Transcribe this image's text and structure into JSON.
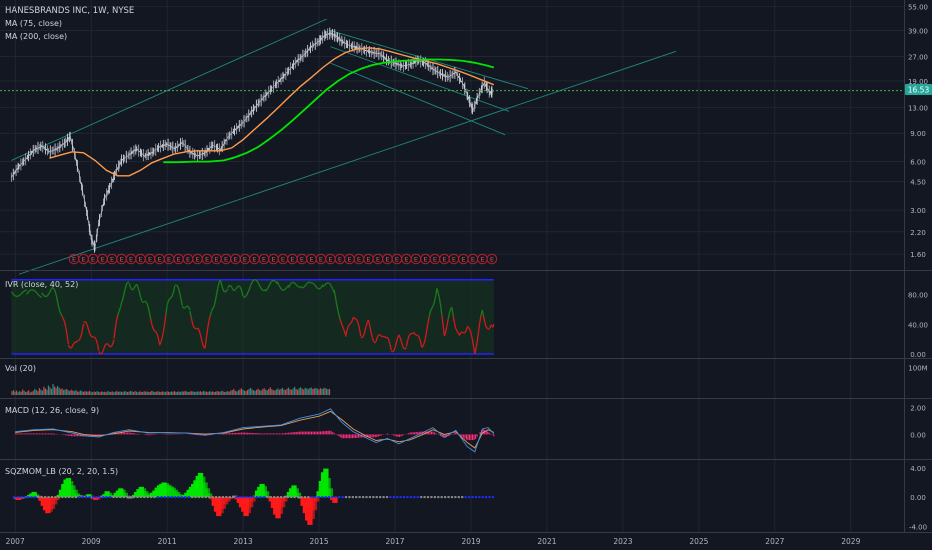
{
  "theme": {
    "background": "#131722",
    "grid": "#2a2e39",
    "separator": "#363a45",
    "text": "#d1d4dc",
    "axis_text": "#b2b5be",
    "price_up": "#cfd2db",
    "ma75_color": "#ff9a4d",
    "ma200_color": "#00e600",
    "channel_color": "#1f8a7d",
    "last_price_line": "#4caf50",
    "earnings_color": "#b3202a",
    "ivr_green": "#1b7a1b",
    "ivr_red": "#d21a1a",
    "ivr_band": "#2323ff",
    "macd_line": "#4a90e2",
    "signal_line": "#e0a060",
    "macd_hist": "#ff2d7a",
    "sqz_green": "#00e600",
    "sqz_red": "#ff1a1a",
    "sqz_gray": "#8c8c8c",
    "vol_up": "#26a69a",
    "vol_down": "#ef5350"
  },
  "header": {
    "symbol_title": "HANESBRANDS INC, 1W, NYSE",
    "ma75_label": "MA (75, close)",
    "ma200_label": "MA (200, close)"
  },
  "last_price_label": "16.53",
  "earnings_marker_label": "E",
  "panes": {
    "ivr": {
      "title": "IVR (close, 40, 52)",
      "ticks": [
        "80.00",
        "40.00",
        "0.00"
      ]
    },
    "vol": {
      "title": "Vol (20)",
      "ticks": [
        "100M"
      ]
    },
    "macd": {
      "title": "MACD (12, 26, close, 9)",
      "ticks": [
        "2.00",
        "0.00"
      ]
    },
    "sqz": {
      "title": "SQZMOM_LB (20, 2, 20, 1.5)",
      "ticks": [
        "4.00",
        "0.00",
        "-4.00"
      ]
    }
  },
  "chart_data": {
    "type": "line",
    "x_axis_labels": [
      "2007",
      "2009",
      "2011",
      "2013",
      "2015",
      "2017",
      "2019",
      "2021",
      "2023",
      "2025",
      "2027",
      "2029"
    ],
    "x_range": [
      2006.6,
      2030.4
    ],
    "price_axis_ticks": [
      "55.00",
      "39.00",
      "27.00",
      "19.00",
      "13.00",
      "9.00",
      "6.00",
      "4.50",
      "3.00",
      "2.20",
      "1.60"
    ],
    "price_scale": "log",
    "price_range": [
      1.35,
      57
    ],
    "last_price": 16.53,
    "price_series": [
      [
        2006.9,
        4.8
      ],
      [
        2007.1,
        5.6
      ],
      [
        2007.3,
        6.3
      ],
      [
        2007.5,
        7.1
      ],
      [
        2007.7,
        7.5
      ],
      [
        2007.9,
        6.9
      ],
      [
        2008.1,
        7.2
      ],
      [
        2008.3,
        7.8
      ],
      [
        2008.45,
        8.6
      ],
      [
        2008.6,
        6.2
      ],
      [
        2008.75,
        4.2
      ],
      [
        2008.9,
        2.8
      ],
      [
        2009.0,
        2.0
      ],
      [
        2009.1,
        1.75
      ],
      [
        2009.2,
        2.5
      ],
      [
        2009.35,
        3.5
      ],
      [
        2009.5,
        4.2
      ],
      [
        2009.65,
        5.2
      ],
      [
        2009.8,
        6.1
      ],
      [
        2010.0,
        6.6
      ],
      [
        2010.2,
        7.2
      ],
      [
        2010.4,
        6.5
      ],
      [
        2010.6,
        6.8
      ],
      [
        2010.8,
        7.4
      ],
      [
        2011.0,
        7.7
      ],
      [
        2011.2,
        7.2
      ],
      [
        2011.4,
        7.9
      ],
      [
        2011.6,
        6.9
      ],
      [
        2011.8,
        6.5
      ],
      [
        2012.0,
        6.8
      ],
      [
        2012.2,
        7.6
      ],
      [
        2012.4,
        7.1
      ],
      [
        2012.6,
        8.5
      ],
      [
        2012.8,
        9.5
      ],
      [
        2013.0,
        10.5
      ],
      [
        2013.2,
        12.0
      ],
      [
        2013.4,
        13.8
      ],
      [
        2013.6,
        15.5
      ],
      [
        2013.8,
        17.5
      ],
      [
        2014.0,
        19.5
      ],
      [
        2014.2,
        22.0
      ],
      [
        2014.4,
        25.0
      ],
      [
        2014.6,
        27.5
      ],
      [
        2014.8,
        31.0
      ],
      [
        2015.0,
        33.5
      ],
      [
        2015.15,
        36.5
      ],
      [
        2015.3,
        37.5
      ],
      [
        2015.45,
        36.0
      ],
      [
        2015.6,
        33.5
      ],
      [
        2015.8,
        31.5
      ],
      [
        2016.0,
        30.5
      ],
      [
        2016.2,
        29.5
      ],
      [
        2016.4,
        28.5
      ],
      [
        2016.6,
        28.0
      ],
      [
        2016.8,
        25.5
      ],
      [
        2017.0,
        24.5
      ],
      [
        2017.2,
        23.5
      ],
      [
        2017.4,
        24.0
      ],
      [
        2017.6,
        25.5
      ],
      [
        2017.8,
        24.5
      ],
      [
        2018.0,
        22.5
      ],
      [
        2018.2,
        21.0
      ],
      [
        2018.4,
        20.0
      ],
      [
        2018.6,
        21.5
      ],
      [
        2018.8,
        18.0
      ],
      [
        2018.95,
        14.5
      ],
      [
        2019.05,
        12.5
      ],
      [
        2019.2,
        15.5
      ],
      [
        2019.35,
        18.5
      ],
      [
        2019.5,
        16.0
      ],
      [
        2019.6,
        16.53
      ]
    ],
    "ma75_series": [
      [
        2007.9,
        6.3
      ],
      [
        2008.2,
        6.6
      ],
      [
        2008.5,
        6.9
      ],
      [
        2008.8,
        6.8
      ],
      [
        2009.1,
        6.1
      ],
      [
        2009.4,
        5.3
      ],
      [
        2009.7,
        4.9
      ],
      [
        2010.0,
        4.9
      ],
      [
        2010.3,
        5.3
      ],
      [
        2010.6,
        5.9
      ],
      [
        2010.9,
        6.3
      ],
      [
        2011.2,
        6.7
      ],
      [
        2011.5,
        6.9
      ],
      [
        2011.8,
        7.0
      ],
      [
        2012.1,
        7.0
      ],
      [
        2012.4,
        7.0
      ],
      [
        2012.7,
        7.3
      ],
      [
        2013.0,
        8.2
      ],
      [
        2013.3,
        9.5
      ],
      [
        2013.6,
        11.0
      ],
      [
        2013.9,
        12.8
      ],
      [
        2014.2,
        15.0
      ],
      [
        2014.5,
        17.5
      ],
      [
        2014.8,
        20.0
      ],
      [
        2015.1,
        23.0
      ],
      [
        2015.4,
        26.0
      ],
      [
        2015.7,
        28.5
      ],
      [
        2016.0,
        30.0
      ],
      [
        2016.3,
        30.5
      ],
      [
        2016.6,
        30.0
      ],
      [
        2016.9,
        28.8
      ],
      [
        2017.2,
        27.5
      ],
      [
        2017.5,
        26.3
      ],
      [
        2017.8,
        25.3
      ],
      [
        2018.1,
        24.3
      ],
      [
        2018.4,
        23.0
      ],
      [
        2018.7,
        21.8
      ],
      [
        2019.0,
        20.5
      ],
      [
        2019.3,
        19.2
      ],
      [
        2019.6,
        18.0
      ]
    ],
    "ma200_series": [
      [
        2010.9,
        5.95
      ],
      [
        2011.3,
        5.95
      ],
      [
        2011.7,
        6.0
      ],
      [
        2012.1,
        6.0
      ],
      [
        2012.5,
        6.1
      ],
      [
        2012.8,
        6.4
      ],
      [
        2013.1,
        6.8
      ],
      [
        2013.4,
        7.4
      ],
      [
        2013.7,
        8.3
      ],
      [
        2014.0,
        9.4
      ],
      [
        2014.3,
        10.8
      ],
      [
        2014.6,
        12.5
      ],
      [
        2014.9,
        14.5
      ],
      [
        2015.2,
        16.8
      ],
      [
        2015.5,
        19.0
      ],
      [
        2015.8,
        21.0
      ],
      [
        2016.1,
        22.6
      ],
      [
        2016.4,
        23.8
      ],
      [
        2016.7,
        24.6
      ],
      [
        2017.0,
        25.1
      ],
      [
        2017.3,
        25.4
      ],
      [
        2017.6,
        25.6
      ],
      [
        2017.9,
        25.8
      ],
      [
        2018.2,
        25.8
      ],
      [
        2018.5,
        25.6
      ],
      [
        2018.8,
        25.3
      ],
      [
        2019.1,
        24.6
      ],
      [
        2019.4,
        23.7
      ],
      [
        2019.6,
        23.0
      ]
    ],
    "channel_lines": [
      {
        "from": [
          2006.9,
          6.1
        ],
        "to": [
          2015.2,
          46.0
        ]
      },
      {
        "from": [
          2007.1,
          1.2
        ],
        "to": [
          2024.4,
          29.0
        ]
      },
      {
        "from": [
          2015.3,
          39.0
        ],
        "to": [
          2020.5,
          17.0
        ]
      },
      {
        "from": [
          2015.3,
          31.0
        ],
        "to": [
          2020.0,
          12.3
        ]
      },
      {
        "from": [
          2015.3,
          24.5
        ],
        "to": [
          2019.9,
          8.8
        ]
      }
    ],
    "earnings_dates": [
      2008.55,
      2008.8,
      2009.05,
      2009.3,
      2009.55,
      2009.8,
      2010.05,
      2010.3,
      2010.55,
      2010.8,
      2011.05,
      2011.3,
      2011.55,
      2011.8,
      2012.05,
      2012.3,
      2012.55,
      2012.8,
      2013.05,
      2013.3,
      2013.55,
      2013.8,
      2014.05,
      2014.3,
      2014.55,
      2014.8,
      2015.05,
      2015.3,
      2015.55,
      2015.8,
      2016.05,
      2016.3,
      2016.55,
      2016.8,
      2017.05,
      2017.3,
      2017.55,
      2017.8,
      2018.05,
      2018.3,
      2018.55,
      2018.8,
      2019.05,
      2019.3,
      2019.55
    ],
    "ivr_range": [
      0,
      105
    ],
    "ivr_series": [
      [
        2006.9,
        85
      ],
      [
        2007.3,
        80
      ],
      [
        2007.7,
        82
      ],
      [
        2008.0,
        85
      ],
      [
        2008.2,
        60
      ],
      [
        2008.4,
        15
      ],
      [
        2008.6,
        10
      ],
      [
        2008.8,
        40
      ],
      [
        2009.0,
        30
      ],
      [
        2009.2,
        5
      ],
      [
        2009.4,
        8
      ],
      [
        2009.6,
        20
      ],
      [
        2009.8,
        75
      ],
      [
        2010.0,
        95
      ],
      [
        2010.2,
        88
      ],
      [
        2010.4,
        72
      ],
      [
        2010.6,
        45
      ],
      [
        2010.8,
        10
      ],
      [
        2011.0,
        60
      ],
      [
        2011.2,
        95
      ],
      [
        2011.4,
        70
      ],
      [
        2011.6,
        55
      ],
      [
        2011.8,
        30
      ],
      [
        2012.0,
        12
      ],
      [
        2012.2,
        65
      ],
      [
        2012.4,
        95
      ],
      [
        2012.6,
        85
      ],
      [
        2012.8,
        92
      ],
      [
        2013.0,
        80
      ],
      [
        2013.3,
        95
      ],
      [
        2013.6,
        90
      ],
      [
        2013.9,
        95
      ],
      [
        2014.2,
        88
      ],
      [
        2014.5,
        96
      ],
      [
        2014.8,
        90
      ],
      [
        2015.1,
        95
      ],
      [
        2015.4,
        85
      ],
      [
        2015.7,
        20
      ],
      [
        2015.9,
        55
      ],
      [
        2016.1,
        25
      ],
      [
        2016.3,
        40
      ],
      [
        2016.5,
        15
      ],
      [
        2016.7,
        30
      ],
      [
        2016.9,
        5
      ],
      [
        2017.1,
        20
      ],
      [
        2017.3,
        10
      ],
      [
        2017.5,
        35
      ],
      [
        2017.7,
        8
      ],
      [
        2017.9,
        45
      ],
      [
        2018.1,
        90
      ],
      [
        2018.3,
        30
      ],
      [
        2018.5,
        60
      ],
      [
        2018.7,
        20
      ],
      [
        2018.9,
        40
      ],
      [
        2019.1,
        5
      ],
      [
        2019.3,
        55
      ],
      [
        2019.5,
        30
      ],
      [
        2019.6,
        45
      ]
    ],
    "ivr_threshold": 50,
    "volume_range": [
      0,
      120000000
    ],
    "volume_start": 2006.9,
    "volume_step": 0.04,
    "volume_values": [
      14,
      18,
      12,
      16,
      10,
      14,
      12,
      20,
      15,
      11,
      13,
      17,
      9,
      12,
      15,
      22,
      18,
      14,
      25,
      20,
      16,
      30,
      24,
      19,
      35,
      28,
      22,
      40,
      31,
      26,
      33,
      27,
      21,
      24,
      18,
      20,
      22,
      17,
      15,
      19,
      16,
      14,
      18,
      13,
      12,
      16,
      15,
      11,
      14,
      13,
      12,
      15,
      12,
      10,
      13,
      11,
      14,
      12,
      10,
      13,
      11,
      12,
      10,
      14,
      12,
      11,
      13,
      10,
      12,
      15,
      11,
      13,
      12,
      10,
      14,
      13,
      11,
      12,
      15,
      13,
      11,
      14,
      12,
      10,
      13,
      12,
      11,
      14,
      12,
      13,
      11,
      12,
      15,
      13,
      11,
      12,
      14,
      12,
      11,
      13,
      12,
      10,
      14,
      12,
      11,
      13,
      12,
      14,
      11,
      12,
      13,
      11,
      14,
      12,
      15,
      13,
      11,
      12,
      14,
      13,
      12,
      11,
      13,
      12,
      14,
      11,
      15,
      13,
      12,
      11,
      14,
      12,
      13,
      11,
      12,
      14,
      13,
      12,
      15,
      13,
      11,
      12,
      14,
      12,
      16,
      18,
      22,
      15,
      13,
      17,
      20,
      24,
      19,
      16,
      14,
      18,
      22,
      26,
      20,
      17,
      15,
      19,
      23,
      18,
      16,
      21,
      25,
      19,
      17,
      22,
      28,
      21,
      18,
      16,
      20,
      24,
      19,
      22,
      26,
      20,
      18,
      23,
      27,
      21,
      19,
      24,
      30,
      22,
      19,
      25,
      28,
      23,
      20,
      26,
      24,
      21,
      25,
      27,
      22,
      24,
      26,
      23,
      20,
      25,
      22,
      24,
      26,
      23,
      21,
      22
    ],
    "macd_range": [
      -1.6,
      2.4
    ],
    "macd_series": [
      [
        2007.0,
        0.2
      ],
      [
        2007.5,
        0.35
      ],
      [
        2008.0,
        0.4
      ],
      [
        2008.5,
        0.1
      ],
      [
        2008.8,
        -0.1
      ],
      [
        2009.2,
        -0.2
      ],
      [
        2009.6,
        0.15
      ],
      [
        2010.0,
        0.35
      ],
      [
        2010.5,
        0.1
      ],
      [
        2011.0,
        0.15
      ],
      [
        2011.5,
        0.1
      ],
      [
        2012.0,
        -0.05
      ],
      [
        2012.5,
        0.15
      ],
      [
        2013.0,
        0.5
      ],
      [
        2013.5,
        0.6
      ],
      [
        2014.0,
        0.7
      ],
      [
        2014.5,
        1.2
      ],
      [
        2015.0,
        1.5
      ],
      [
        2015.3,
        1.9
      ],
      [
        2015.6,
        0.9
      ],
      [
        2015.9,
        0.2
      ],
      [
        2016.2,
        -0.2
      ],
      [
        2016.5,
        -0.6
      ],
      [
        2016.8,
        -0.3
      ],
      [
        2017.1,
        -0.7
      ],
      [
        2017.4,
        -0.3
      ],
      [
        2017.7,
        0.1
      ],
      [
        2018.0,
        0.5
      ],
      [
        2018.3,
        -0.2
      ],
      [
        2018.6,
        0.3
      ],
      [
        2018.9,
        -0.9
      ],
      [
        2019.1,
        -1.3
      ],
      [
        2019.3,
        0.4
      ],
      [
        2019.45,
        0.5
      ],
      [
        2019.6,
        0.05
      ]
    ],
    "signal_series": [
      [
        2007.0,
        0.15
      ],
      [
        2007.5,
        0.3
      ],
      [
        2008.0,
        0.35
      ],
      [
        2008.5,
        0.2
      ],
      [
        2008.8,
        0.0
      ],
      [
        2009.2,
        -0.1
      ],
      [
        2009.6,
        0.05
      ],
      [
        2010.0,
        0.25
      ],
      [
        2010.5,
        0.15
      ],
      [
        2011.0,
        0.12
      ],
      [
        2011.5,
        0.1
      ],
      [
        2012.0,
        0.02
      ],
      [
        2012.5,
        0.1
      ],
      [
        2013.0,
        0.4
      ],
      [
        2013.5,
        0.55
      ],
      [
        2014.0,
        0.65
      ],
      [
        2014.5,
        1.05
      ],
      [
        2015.0,
        1.35
      ],
      [
        2015.3,
        1.7
      ],
      [
        2015.6,
        1.1
      ],
      [
        2015.9,
        0.4
      ],
      [
        2016.2,
        -0.05
      ],
      [
        2016.5,
        -0.45
      ],
      [
        2016.8,
        -0.35
      ],
      [
        2017.1,
        -0.55
      ],
      [
        2017.4,
        -0.4
      ],
      [
        2017.7,
        -0.05
      ],
      [
        2018.0,
        0.35
      ],
      [
        2018.3,
        0.0
      ],
      [
        2018.6,
        0.2
      ],
      [
        2018.9,
        -0.6
      ],
      [
        2019.1,
        -1.0
      ],
      [
        2019.3,
        0.1
      ],
      [
        2019.45,
        0.35
      ],
      [
        2019.6,
        0.15
      ]
    ],
    "sqz_range": [
      -4.5,
      4.8
    ],
    "sqz_start": 2006.95,
    "sqz_step": 0.06,
    "sqz_values": [
      -0.2,
      -0.4,
      -0.3,
      -0.2,
      -0.1,
      0.1,
      0.3,
      0.5,
      0.7,
      0.4,
      0.2,
      -0.5,
      -1.2,
      -1.8,
      -2.2,
      -2.0,
      -1.6,
      -1.0,
      -0.4,
      0.3,
      1.0,
      1.8,
      2.4,
      2.6,
      2.2,
      1.6,
      1.0,
      0.5,
      0.3,
      0.2,
      0.1,
      0.2,
      0.4,
      0.2,
      -0.2,
      -0.4,
      -0.3,
      -0.1,
      0.2,
      0.4,
      0.8,
      0.6,
      0.3,
      0.2,
      0.6,
      0.9,
      1.2,
      1.0,
      0.6,
      0.2,
      -0.2,
      -0.1,
      0.3,
      0.7,
      1.1,
      1.4,
      1.2,
      0.8,
      0.5,
      0.3,
      0.6,
      0.9,
      1.3,
      1.6,
      1.8,
      2.0,
      1.9,
      1.7,
      1.5,
      1.3,
      1.0,
      0.7,
      0.4,
      0.2,
      0.3,
      0.6,
      1.0,
      1.4,
      1.8,
      2.3,
      2.9,
      3.3,
      2.8,
      2.0,
      1.2,
      0.5,
      -0.3,
      -1.2,
      -2.0,
      -2.6,
      -2.2,
      -1.6,
      -1.0,
      -0.6,
      -0.3,
      -0.1,
      0.2,
      -0.3,
      -0.8,
      -1.4,
      -2.0,
      -2.6,
      -2.2,
      -1.4,
      -0.6,
      0.2,
      0.9,
      1.4,
      1.8,
      1.5,
      0.8,
      0.1,
      -0.6,
      -1.5,
      -2.4,
      -2.9,
      -2.3,
      -1.4,
      -0.6,
      0.2,
      0.7,
      1.2,
      1.6,
      1.2,
      0.6,
      -0.2,
      -1.2,
      -2.2,
      -3.2,
      -3.8,
      -3.0,
      -1.8,
      -0.6,
      0.8,
      2.2,
      3.4,
      3.9,
      2.6,
      1.2,
      -0.4,
      -0.8
    ]
  }
}
